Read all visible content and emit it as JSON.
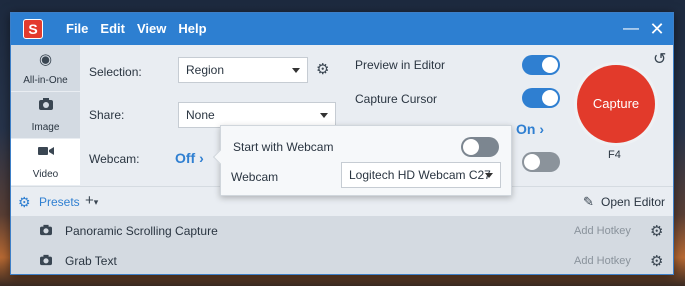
{
  "window": {
    "logo": "S"
  },
  "menu": {
    "items": [
      "File",
      "Edit",
      "View",
      "Help"
    ]
  },
  "window_controls": {
    "minimize": "—",
    "close": "✕"
  },
  "modes": [
    {
      "label": "All-in-One",
      "icon": "circle-icon"
    },
    {
      "label": "Image",
      "icon": "camera-icon"
    },
    {
      "label": "Video",
      "icon": "video-camera-icon"
    }
  ],
  "settings": {
    "selection_label": "Selection:",
    "selection_value": "Region",
    "share_label": "Share:",
    "share_value": "None",
    "webcam_label": "Webcam:",
    "webcam_value": "Off",
    "preview_label": "Preview in Editor",
    "cursor_label": "Capture Cursor",
    "on_link": "On"
  },
  "popup": {
    "start_with_webcam_label": "Start with Webcam",
    "webcam_label": "Webcam",
    "webcam_device": "Logitech HD Webcam C27"
  },
  "capture": {
    "label": "Capture",
    "hotkey": "F4"
  },
  "presets": {
    "label": "Presets",
    "add_symbol": "+",
    "open_editor": "Open Editor",
    "items": [
      {
        "name": "Panoramic Scrolling Capture",
        "hotkey": "Add Hotkey"
      },
      {
        "name": "Grab Text",
        "hotkey": "Add Hotkey"
      }
    ]
  },
  "colors": {
    "accent": "#2f7fd1",
    "capture": "#e23a2b",
    "titlebar": "#2d7fd1"
  }
}
